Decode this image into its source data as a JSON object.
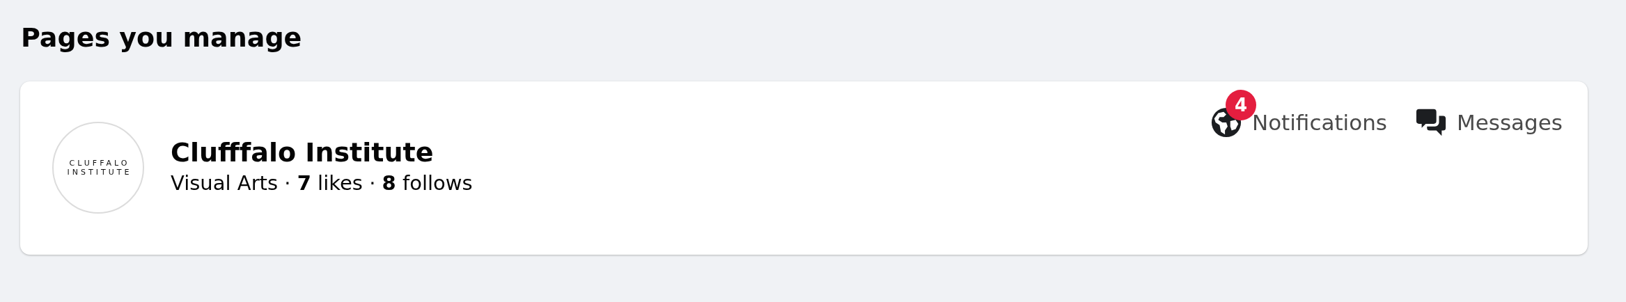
{
  "heading": "Pages you manage",
  "page": {
    "logo_lines": [
      "CLUFFALO",
      "INSTITUTE"
    ],
    "name": "Clufffalo Institute",
    "details": "Visual Arts · **7** likes · **8** follows"
  },
  "actions": [
    {
      "kind": "notifications",
      "label": "Notifications",
      "badge": "4"
    },
    {
      "kind": "messages",
      "label": "Messages"
    }
  ]
}
